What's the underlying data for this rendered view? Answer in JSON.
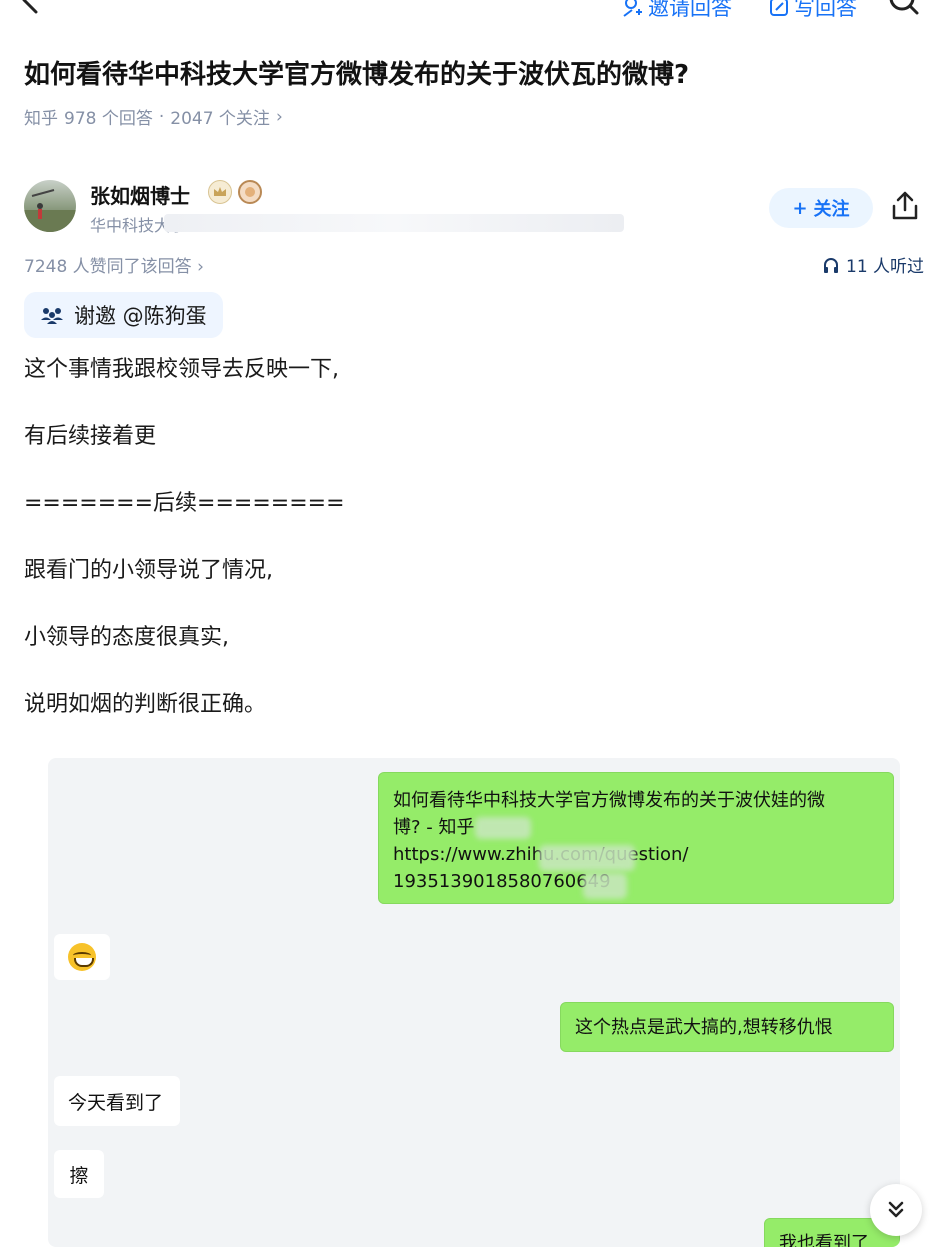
{
  "nav": {
    "invite_label": "邀请回答",
    "write_label": "写回答"
  },
  "question": {
    "title": "如何看待华中科技大学官方微博发布的关于波伏瓦的微博?",
    "meta_prefix": "知乎",
    "answers": "978 个回答",
    "separator": "·",
    "followers": "2047 个关注",
    "chevron": "›"
  },
  "author": {
    "name": "张如烟博士",
    "bio": "华中科技大学",
    "follow_label": "关注",
    "follow_plus": "+"
  },
  "stats": {
    "likes": "7248 人赞同了该回答",
    "chevron": "›",
    "listeners": "11 人听过"
  },
  "thanks": {
    "label": "谢邀 @陈狗蛋"
  },
  "content": {
    "paragraphs": [
      "这个事情我跟校领导去反映一下,",
      "有后续接着更",
      "=======后续========",
      "跟看门的小领导说了情况,",
      "小领导的态度很真实,",
      "说明如烟的判断很正确。"
    ]
  },
  "chat": {
    "link_line1": "如何看待华中科技大学官方微博发布的关于波伏娃的微",
    "link_line2": "博? - 知乎",
    "link_line3": "https://www.zhihu.com/question/",
    "link_line4": "1935139018580760649",
    "msg2": "这个热点是武大搞的,想转移仇恨",
    "msg3": "今天看到了",
    "msg4": "擦",
    "msg5": "我也看到了"
  },
  "colors": {
    "accent": "#1772f6",
    "green_bubble": "#95ec69",
    "meta_gray": "#8590a6"
  }
}
